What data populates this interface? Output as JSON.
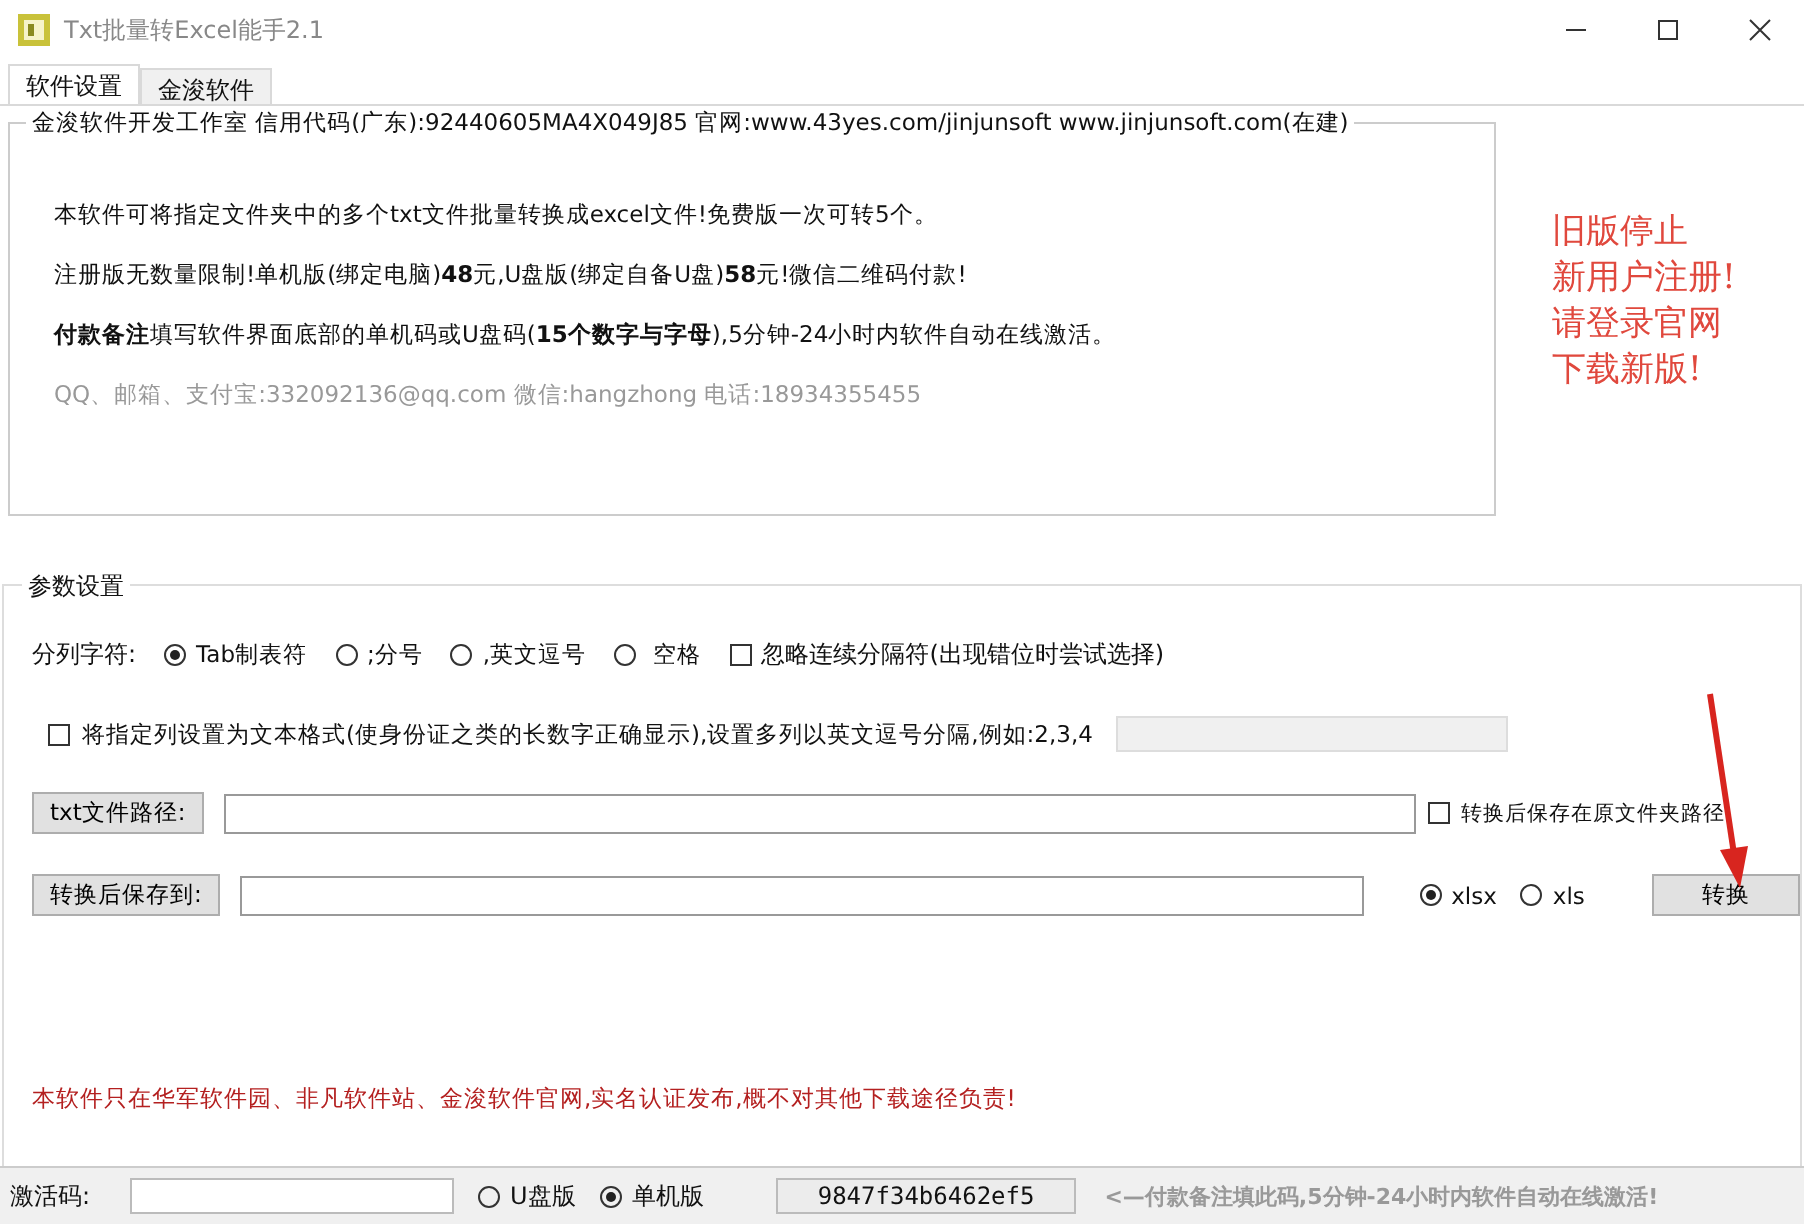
{
  "window": {
    "title": "Txt批量转Excel能手2.1"
  },
  "tabs": [
    {
      "label": "软件设置",
      "selected": true
    },
    {
      "label": "金浚软件",
      "selected": false
    }
  ],
  "info": {
    "legend": "金浚软件开发工作室 信用代码(广东):92440605MA4X049J85 官网:www.43yes.com/jinjunsoft  www.jinjunsoft.com(在建)",
    "lines": [
      "本软件可将指定文件夹中的多个txt文件批量转换成excel文件!免费版一次可转5个。",
      "注册版无数量限制!单机版(绑定电脑)**48**元,U盘版(绑定自备U盘)**58**元!微信二维码付款!",
      "**付款备注**填写软件界面底部的单机码或U盘码(**15个数字与字母**),5分钟-24小时内软件自动在线激活。"
    ],
    "contact": "QQ、邮箱、支付宝:332092136@qq.com   微信:hangzhong   电话:18934355455"
  },
  "notice": [
    "旧版停止",
    "新用户注册!",
    "请登录官网",
    "下载新版!"
  ],
  "params": {
    "legend": "参数设置",
    "separator": {
      "label": "分列字符:",
      "options": [
        {
          "label": "Tab制表符",
          "selected": true
        },
        {
          "label": ";分号",
          "selected": false
        },
        {
          "label": ",英文逗号",
          "selected": false
        },
        {
          "label": " 空格",
          "selected": false
        }
      ],
      "ignore": {
        "label": "忽略连续分隔符(出现错位时尝试选择)",
        "checked": false
      }
    },
    "text_columns": {
      "label": "将指定列设置为文本格式(使身份证之类的长数字正确显示),设置多列以英文逗号分隔,例如:2,3,4",
      "checked": false
    },
    "txt_path": {
      "button": "txt文件路径:",
      "keep": {
        "label": "转换后保存在原文件夹路径",
        "checked": false
      }
    },
    "save_to": {
      "button": "转换后保存到:",
      "formats": [
        {
          "label": "xlsx",
          "selected": true
        },
        {
          "label": "xls",
          "selected": false
        }
      ],
      "convert": "转换"
    },
    "disclaimer": "本软件只在华军软件园、非凡软件站、金浚软件官网,实名认证发布,概不对其他下载途径负责!"
  },
  "activation": {
    "label": "激活码:",
    "editions": [
      {
        "label": "U盘版",
        "selected": false
      },
      {
        "label": "单机版",
        "selected": true
      }
    ],
    "code": "9847f34b6462ef5",
    "hint": "<—付款备注填此码,5分钟-24小时内软件自动在线激活!"
  }
}
